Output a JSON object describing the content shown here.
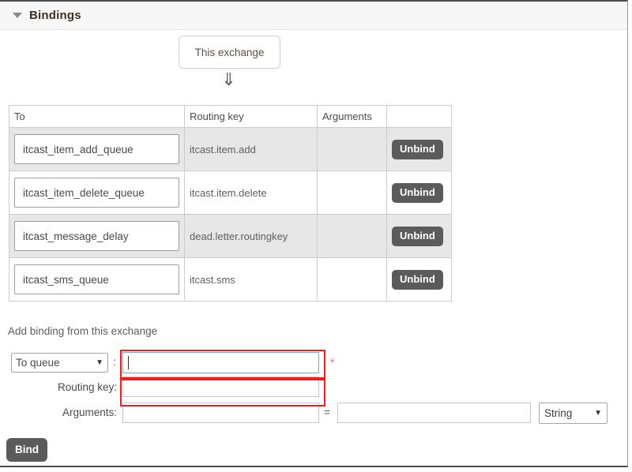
{
  "section": {
    "title": "Bindings",
    "collapse_icon": "triangle-down-icon"
  },
  "graph": {
    "source_node_label": "This exchange",
    "arrow_glyph": "⇓"
  },
  "bindings_table": {
    "columns": [
      "To",
      "Routing key",
      "Arguments",
      ""
    ],
    "rows": [
      {
        "to": "itcast_item_add_queue",
        "routing_key": "itcast.item.add",
        "arguments": "",
        "action_label": "Unbind"
      },
      {
        "to": "itcast_item_delete_queue",
        "routing_key": "itcast.item.delete",
        "arguments": "",
        "action_label": "Unbind"
      },
      {
        "to": "itcast_message_delay",
        "routing_key": "dead.letter.routingkey",
        "arguments": "",
        "action_label": "Unbind"
      },
      {
        "to": "itcast_sms_queue",
        "routing_key": "itcast.sms",
        "arguments": "",
        "action_label": "Unbind"
      }
    ]
  },
  "add_binding_form": {
    "caption": "Add binding from this exchange",
    "destination_type": {
      "selected": "To queue",
      "caret": "▼"
    },
    "separator_colon": ":",
    "destination_input": {
      "value": "",
      "placeholder": ""
    },
    "required_marker": "*",
    "routing_key": {
      "label": "Routing key:",
      "value": "",
      "placeholder": ""
    },
    "arguments": {
      "label": "Arguments:",
      "key_value": "",
      "equals": "=",
      "value_value": "",
      "type_selected": "String",
      "type_caret": "▼"
    },
    "submit_label": "Bind"
  },
  "colors": {
    "annotation": "#f01d1d",
    "button": "#5b5b5b",
    "focus_border": "#7aa8d8",
    "header_bg": "#f7f7f7",
    "row_stripe": "#e7e7e7"
  }
}
